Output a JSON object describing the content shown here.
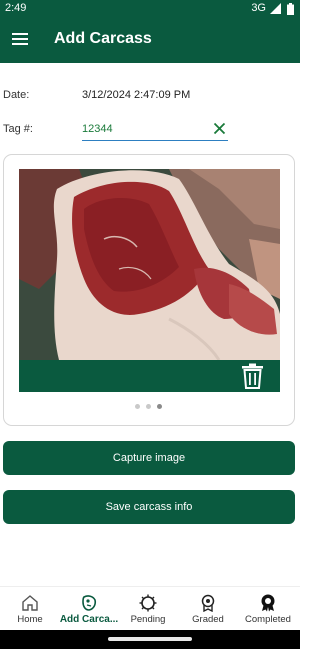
{
  "status_bar": {
    "time": "2:49",
    "network": "3G"
  },
  "app_bar": {
    "title": "Add Carcass"
  },
  "form": {
    "date_label": "Date:",
    "date_value": "3/12/2024 2:47:09 PM",
    "tag_label": "Tag #:",
    "tag_value": "12344"
  },
  "image_carousel": {
    "page_count": 3,
    "active_page": 3
  },
  "buttons": {
    "capture_label": "Capture image",
    "save_label": "Save carcass info"
  },
  "bottom_nav": {
    "items": [
      {
        "label": "Home",
        "icon": "home-icon"
      },
      {
        "label": "Add Carca...",
        "icon": "add-carcass-icon",
        "active": true
      },
      {
        "label": "Pending",
        "icon": "pending-icon"
      },
      {
        "label": "Graded",
        "icon": "graded-icon"
      },
      {
        "label": "Completed",
        "icon": "completed-icon"
      }
    ]
  },
  "colors": {
    "primary": "#0a5a3f",
    "input_underline": "#2d7fc1",
    "input_text": "#1a7a3a"
  }
}
